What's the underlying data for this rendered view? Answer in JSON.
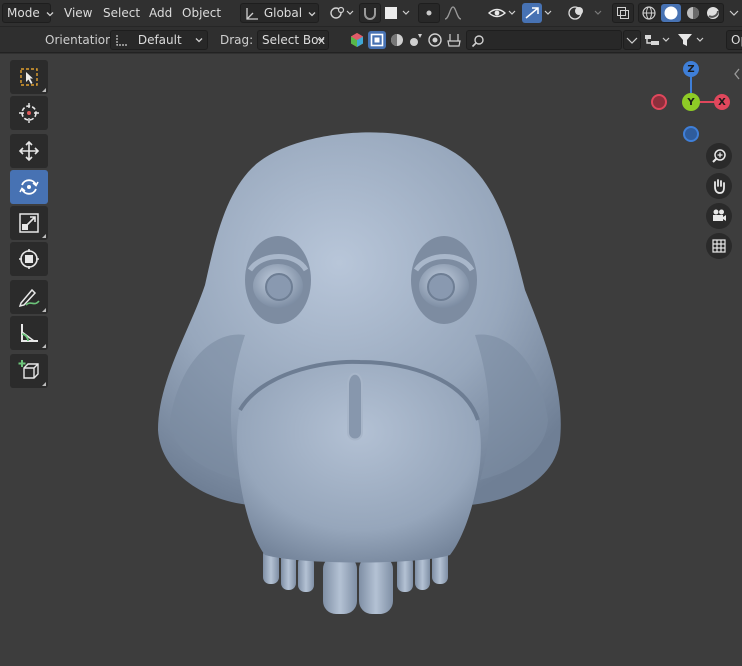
{
  "header": {
    "mode_label": "Mode",
    "menus": {
      "view": "View",
      "select": "Select",
      "add": "Add",
      "object": "Object"
    },
    "transform_orientation": "Global"
  },
  "tool_header": {
    "orientation_label": "Orientation:",
    "orientation_value": "Default",
    "drag_label": "Drag:",
    "drag_value": "Select Box",
    "search_placeholder": "",
    "options_label": "Op"
  },
  "toolbar": {
    "tools": [
      {
        "name": "select-box",
        "icon": "select-box-icon",
        "active": false
      },
      {
        "name": "cursor",
        "icon": "cursor-icon",
        "active": false
      },
      {
        "name": "move",
        "icon": "move-icon",
        "active": false
      },
      {
        "name": "rotate",
        "icon": "rotate-icon",
        "active": true
      },
      {
        "name": "scale",
        "icon": "scale-icon",
        "active": false
      },
      {
        "name": "transform",
        "icon": "transform-icon",
        "active": false
      },
      {
        "name": "annotate",
        "icon": "annotate-icon",
        "active": false
      },
      {
        "name": "measure",
        "icon": "measure-icon",
        "active": false
      },
      {
        "name": "add-cube",
        "icon": "add-cube-icon",
        "active": false
      }
    ]
  },
  "gizmo": {
    "z": "Z",
    "y": "Y",
    "x": "X"
  },
  "colors": {
    "accent": "#4772b3",
    "axis_x": "#e0475c",
    "axis_y": "#8ecb26",
    "axis_z": "#3f7fd8",
    "viewport_bg": "#3d3d3d",
    "mesh": "#9aaac0"
  }
}
